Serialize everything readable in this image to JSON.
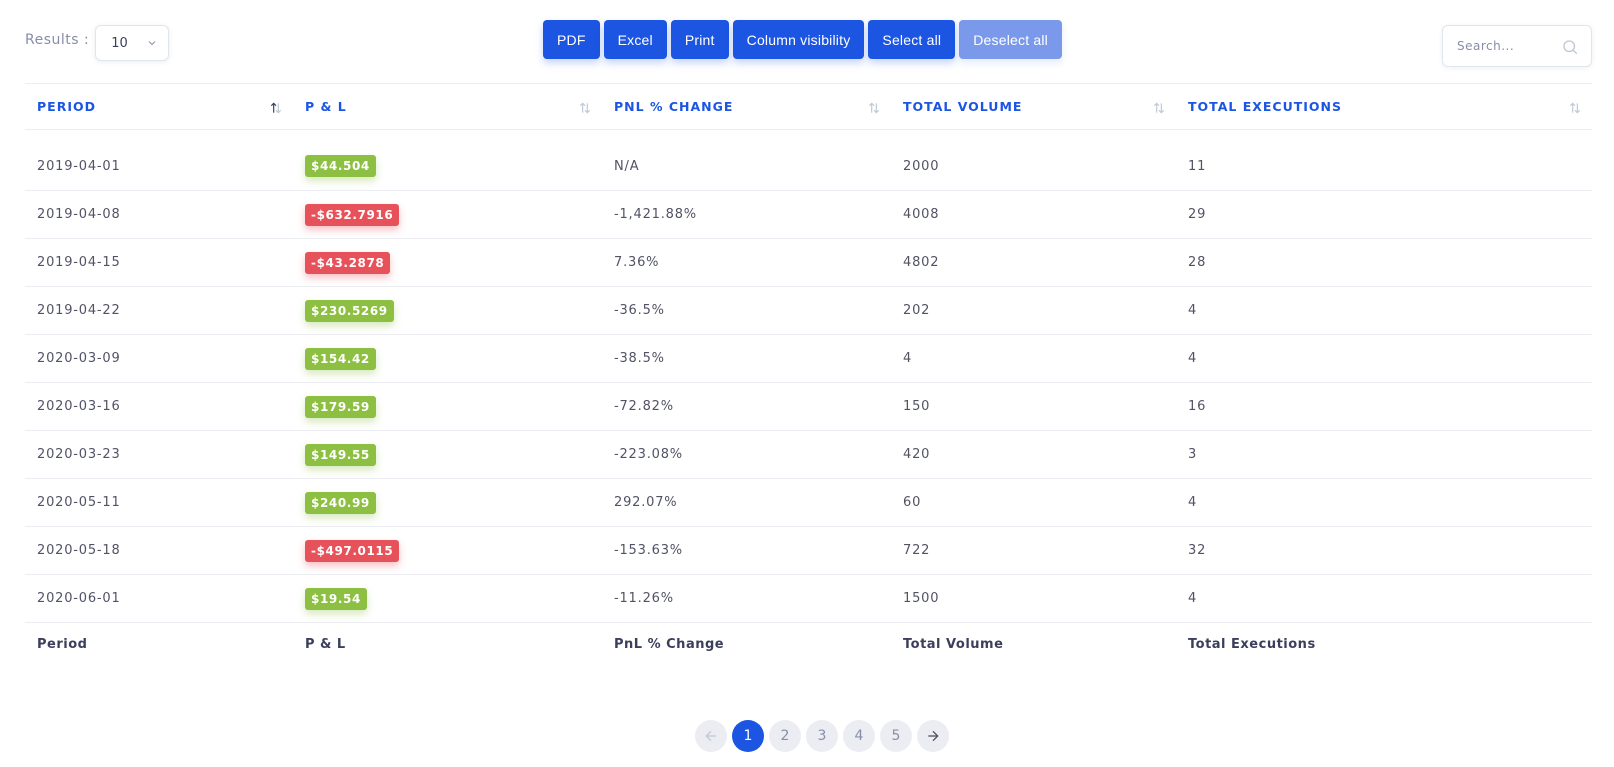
{
  "toolbar": {
    "results_label": "Results :",
    "results_value": "10",
    "buttons": [
      "PDF",
      "Excel",
      "Print",
      "Column visibility",
      "Select all",
      "Deselect all"
    ],
    "search_placeholder": "Search..."
  },
  "table": {
    "headers": [
      "PERIOD",
      "P & L",
      "PNL % CHANGE",
      "TOTAL VOLUME",
      "TOTAL EXECUTIONS"
    ],
    "footers": [
      "Period",
      "P & L",
      "PnL % Change",
      "Total Volume",
      "Total Executions"
    ],
    "rows": [
      {
        "period": "2019-04-01",
        "pnl": "$44.504",
        "pnl_sign": "pos",
        "pct": "N/A",
        "volume": "2000",
        "executions": "11"
      },
      {
        "period": "2019-04-08",
        "pnl": "-$632.7916",
        "pnl_sign": "neg",
        "pct": "-1,421.88%",
        "volume": "4008",
        "executions": "29"
      },
      {
        "period": "2019-04-15",
        "pnl": "-$43.2878",
        "pnl_sign": "neg",
        "pct": "7.36%",
        "volume": "4802",
        "executions": "28"
      },
      {
        "period": "2019-04-22",
        "pnl": "$230.5269",
        "pnl_sign": "pos",
        "pct": "-36.5%",
        "volume": "202",
        "executions": "4"
      },
      {
        "period": "2020-03-09",
        "pnl": "$154.42",
        "pnl_sign": "pos",
        "pct": "-38.5%",
        "volume": "4",
        "executions": "4"
      },
      {
        "period": "2020-03-16",
        "pnl": "$179.59",
        "pnl_sign": "pos",
        "pct": "-72.82%",
        "volume": "150",
        "executions": "16"
      },
      {
        "period": "2020-03-23",
        "pnl": "$149.55",
        "pnl_sign": "pos",
        "pct": "-223.08%",
        "volume": "420",
        "executions": "3"
      },
      {
        "period": "2020-05-11",
        "pnl": "$240.99",
        "pnl_sign": "pos",
        "pct": "292.07%",
        "volume": "60",
        "executions": "4"
      },
      {
        "period": "2020-05-18",
        "pnl": "-$497.0115",
        "pnl_sign": "neg",
        "pct": "-153.63%",
        "volume": "722",
        "executions": "32"
      },
      {
        "period": "2020-06-01",
        "pnl": "$19.54",
        "pnl_sign": "pos",
        "pct": "-11.26%",
        "volume": "1500",
        "executions": "4"
      }
    ]
  },
  "pagination": {
    "pages": [
      "1",
      "2",
      "3",
      "4",
      "5"
    ],
    "active": "1",
    "prev_icon": "arrow-left-icon",
    "next_icon": "arrow-right-icon"
  },
  "colors": {
    "accent": "#1b55e2",
    "positive": "#8dbf42",
    "negative": "#e7515a"
  }
}
